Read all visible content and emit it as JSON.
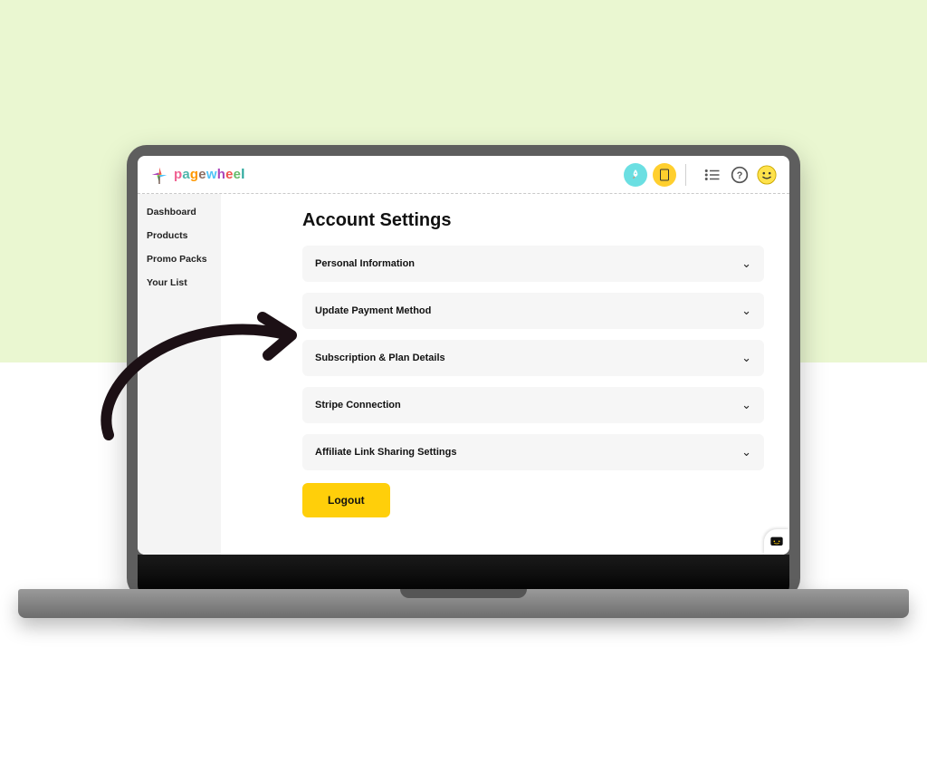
{
  "brand": {
    "letters": [
      "p",
      "a",
      "g",
      "e",
      "w",
      "h",
      "e",
      "e",
      "l"
    ]
  },
  "sidebar": {
    "items": [
      {
        "label": "Dashboard"
      },
      {
        "label": "Products"
      },
      {
        "label": "Promo Packs"
      },
      {
        "label": "Your List"
      }
    ]
  },
  "page": {
    "title": "Account Settings"
  },
  "accordion": {
    "items": [
      {
        "label": "Personal Information"
      },
      {
        "label": "Update Payment Method"
      },
      {
        "label": "Subscription & Plan Details"
      },
      {
        "label": "Stripe Connection"
      },
      {
        "label": "Affiliate Link Sharing Settings"
      }
    ]
  },
  "logout": {
    "label": "Logout"
  }
}
